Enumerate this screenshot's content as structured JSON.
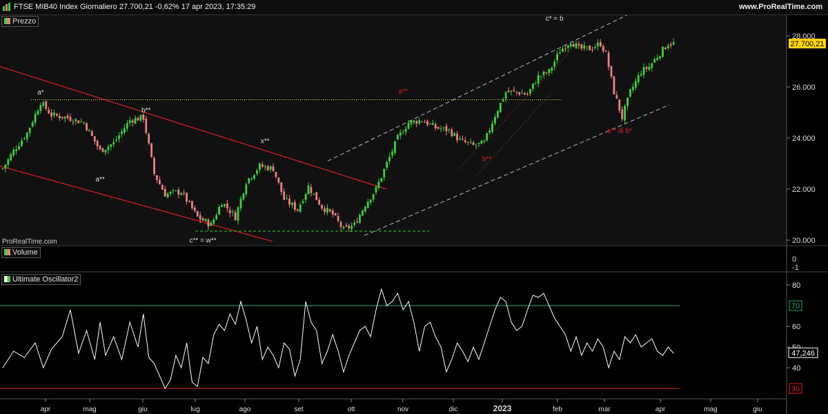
{
  "header": {
    "title": "FTSE MIB40 Index Giornaliero 27.700,21 -0,62% 17 apr 2023, 17:35:29",
    "site": "www.ProRealTime.com"
  },
  "panels": {
    "price_label": "Prezzo",
    "volume_label": "Volume",
    "osc_label": "Ultimate Oscillator2"
  },
  "watermark": "ProRealTime.com",
  "colors": {
    "up": "#3fcf3f",
    "down": "#f08080",
    "trend": "#e02020",
    "channel": "#b8b8d8",
    "fib": "#c04818",
    "dotted_level": "#e0e040",
    "support": "#30d030",
    "osc_line": "#ffffff",
    "osc_upper": "#20b070",
    "osc_lower": "#e02020",
    "last_price_bg": "#ffd700"
  },
  "chart_data": [
    {
      "type": "candlestick",
      "panel": "Prezzo",
      "ylim": [
        19800,
        28600
      ],
      "yticks": [
        "28.000",
        "26.000",
        "24.000",
        "22.000",
        "20.000"
      ],
      "last_value": "27.700,21",
      "x_labels": [
        "apr",
        "mag",
        "giu",
        "lug",
        "ago",
        "set",
        "ott",
        "nov",
        "dic",
        "2023",
        "feb",
        "mar",
        "apr",
        "mag",
        "giu"
      ],
      "close_path": [
        [
          0,
          22800
        ],
        [
          4,
          23500
        ],
        [
          9,
          24200
        ],
        [
          14,
          25400
        ],
        [
          18,
          24900
        ],
        [
          24,
          24800
        ],
        [
          30,
          24600
        ],
        [
          36,
          23500
        ],
        [
          41,
          23800
        ],
        [
          47,
          24700
        ],
        [
          52,
          24800
        ],
        [
          56,
          22600
        ],
        [
          60,
          21800
        ],
        [
          66,
          21900
        ],
        [
          72,
          20900
        ],
        [
          77,
          20600
        ],
        [
          81,
          21500
        ],
        [
          86,
          20900
        ],
        [
          90,
          22300
        ],
        [
          95,
          22900
        ],
        [
          100,
          22800
        ],
        [
          104,
          21600
        ],
        [
          109,
          21200
        ],
        [
          113,
          22100
        ],
        [
          118,
          21300
        ],
        [
          122,
          21000
        ],
        [
          126,
          20400
        ],
        [
          130,
          20600
        ],
        [
          134,
          21400
        ],
        [
          138,
          22000
        ],
        [
          142,
          23000
        ],
        [
          146,
          24000
        ],
        [
          150,
          24600
        ],
        [
          155,
          24700
        ],
        [
          160,
          24400
        ],
        [
          165,
          24300
        ],
        [
          169,
          23900
        ],
        [
          174,
          23700
        ],
        [
          178,
          23800
        ],
        [
          182,
          24900
        ],
        [
          186,
          25800
        ],
        [
          190,
          25800
        ],
        [
          194,
          25700
        ],
        [
          198,
          26400
        ],
        [
          202,
          26600
        ],
        [
          206,
          27400
        ],
        [
          210,
          27800
        ],
        [
          213,
          27500
        ],
        [
          217,
          27500
        ],
        [
          221,
          27700
        ],
        [
          223,
          27300
        ],
        [
          226,
          25800
        ],
        [
          229,
          24800
        ],
        [
          232,
          25800
        ],
        [
          236,
          26600
        ],
        [
          239,
          26800
        ],
        [
          242,
          27200
        ],
        [
          246,
          27700
        ],
        [
          248,
          27700
        ]
      ],
      "annotations": [
        {
          "text": "a*",
          "x": 14,
          "y": 25700,
          "color": "#ddd"
        },
        {
          "text": "b**",
          "x": 53,
          "y": 25000,
          "color": "#ddd"
        },
        {
          "text": "a**",
          "x": 36,
          "y": 22300,
          "color": "#ddd"
        },
        {
          "text": "x**",
          "x": 97,
          "y": 23800,
          "color": "#ddd"
        },
        {
          "text": "c** = w**",
          "x": 74,
          "y": 19900,
          "color": "#ddd"
        },
        {
          "text": "a**",
          "x": 148,
          "y": 25750,
          "color": "#e02020"
        },
        {
          "text": "b**",
          "x": 179,
          "y": 23100,
          "color": "#e02020"
        },
        {
          "text": "c* = b",
          "x": 204,
          "y": 28600,
          "color": "#ddd"
        },
        {
          "text": "a** di b*",
          "x": 228,
          "y": 24200,
          "color": "#e02020"
        }
      ]
    },
    {
      "type": "bar",
      "panel": "Volume",
      "yticks": [
        "0",
        "-1"
      ]
    },
    {
      "type": "line",
      "panel": "Ultimate Oscillator2",
      "ylim": [
        25,
        85
      ],
      "yticks": [
        "80",
        "60",
        "50",
        "40"
      ],
      "levels": [
        "70",
        "30"
      ],
      "last_value": "47,246",
      "path": [
        [
          0,
          40
        ],
        [
          4,
          48
        ],
        [
          8,
          45
        ],
        [
          12,
          52
        ],
        [
          15,
          40
        ],
        [
          18,
          49
        ],
        [
          22,
          55
        ],
        [
          25,
          68
        ],
        [
          28,
          47
        ],
        [
          31,
          58
        ],
        [
          34,
          44
        ],
        [
          36,
          62
        ],
        [
          38,
          46
        ],
        [
          41,
          55
        ],
        [
          44,
          44
        ],
        [
          47,
          62
        ],
        [
          50,
          50
        ],
        [
          52,
          66
        ],
        [
          54,
          45
        ],
        [
          56,
          42
        ],
        [
          58,
          36
        ],
        [
          60,
          30
        ],
        [
          62,
          34
        ],
        [
          64,
          46
        ],
        [
          66,
          40
        ],
        [
          68,
          52
        ],
        [
          70,
          33
        ],
        [
          72,
          31
        ],
        [
          74,
          45
        ],
        [
          76,
          42
        ],
        [
          78,
          56
        ],
        [
          80,
          61
        ],
        [
          82,
          58
        ],
        [
          84,
          66
        ],
        [
          86,
          61
        ],
        [
          88,
          72
        ],
        [
          90,
          63
        ],
        [
          92,
          52
        ],
        [
          94,
          60
        ],
        [
          96,
          44
        ],
        [
          98,
          50
        ],
        [
          100,
          46
        ],
        [
          102,
          40
        ],
        [
          104,
          52
        ],
        [
          106,
          49
        ],
        [
          108,
          36
        ],
        [
          110,
          44
        ],
        [
          112,
          72
        ],
        [
          114,
          62
        ],
        [
          116,
          58
        ],
        [
          118,
          42
        ],
        [
          120,
          48
        ],
        [
          122,
          56
        ],
        [
          124,
          48
        ],
        [
          126,
          38
        ],
        [
          128,
          46
        ],
        [
          130,
          52
        ],
        [
          132,
          58
        ],
        [
          134,
          60
        ],
        [
          136,
          55
        ],
        [
          138,
          68
        ],
        [
          140,
          78
        ],
        [
          142,
          70
        ],
        [
          144,
          72
        ],
        [
          146,
          76
        ],
        [
          148,
          68
        ],
        [
          150,
          72
        ],
        [
          152,
          62
        ],
        [
          154,
          48
        ],
        [
          156,
          60
        ],
        [
          158,
          62
        ],
        [
          160,
          55
        ],
        [
          162,
          50
        ],
        [
          164,
          38
        ],
        [
          166,
          44
        ],
        [
          168,
          52
        ],
        [
          170,
          48
        ],
        [
          172,
          43
        ],
        [
          174,
          50
        ],
        [
          176,
          44
        ],
        [
          178,
          52
        ],
        [
          180,
          60
        ],
        [
          182,
          68
        ],
        [
          184,
          74
        ],
        [
          186,
          72
        ],
        [
          188,
          62
        ],
        [
          190,
          58
        ],
        [
          192,
          60
        ],
        [
          194,
          68
        ],
        [
          196,
          75
        ],
        [
          198,
          74
        ],
        [
          200,
          76
        ],
        [
          202,
          70
        ],
        [
          204,
          64
        ],
        [
          206,
          60
        ],
        [
          208,
          56
        ],
        [
          210,
          48
        ],
        [
          212,
          55
        ],
        [
          214,
          46
        ],
        [
          216,
          52
        ],
        [
          218,
          48
        ],
        [
          220,
          54
        ],
        [
          222,
          50
        ],
        [
          224,
          40
        ],
        [
          226,
          48
        ],
        [
          228,
          44
        ],
        [
          230,
          55
        ],
        [
          232,
          52
        ],
        [
          234,
          56
        ],
        [
          236,
          50
        ],
        [
          238,
          52
        ],
        [
          240,
          54
        ],
        [
          242,
          48
        ],
        [
          244,
          46
        ],
        [
          246,
          50
        ],
        [
          248,
          47
        ]
      ]
    }
  ]
}
